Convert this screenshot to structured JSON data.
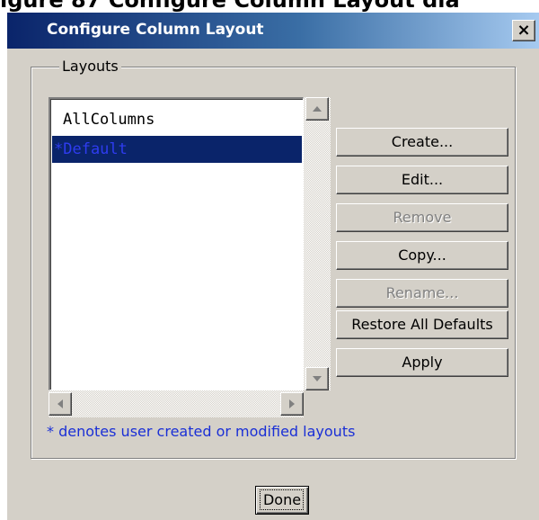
{
  "background_caption": "igure 87 Configure Column Layout dia",
  "window": {
    "title": "Configure Column Layout",
    "close_label": "×",
    "colors": {
      "titlebar": "#0a246a",
      "face": "#d4d0c8",
      "selection": "#0a246a",
      "note_text": "#1a2fd6"
    }
  },
  "layouts_group": {
    "label": "Layouts",
    "items": [
      {
        "label": "AllColumns",
        "selected": false
      },
      {
        "label": "*Default",
        "selected": true
      }
    ]
  },
  "buttons": {
    "create": "Create...",
    "edit": "Edit...",
    "remove": "Remove",
    "copy": "Copy...",
    "rename": "Rename...",
    "restore_defaults": "Restore All Defaults",
    "apply": "Apply"
  },
  "disabled_buttons": [
    "remove",
    "rename"
  ],
  "note": "* denotes user created or modified layouts",
  "done_label": "Done",
  "icons": {
    "scroll_up": "arrow-up-icon",
    "scroll_down": "arrow-down-icon",
    "scroll_left": "arrow-left-icon",
    "scroll_right": "arrow-right-icon"
  }
}
